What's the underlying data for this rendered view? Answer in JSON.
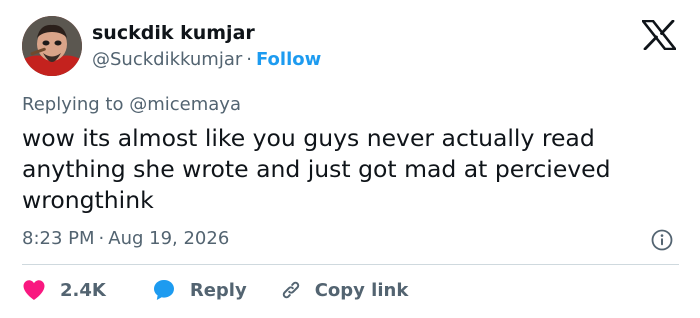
{
  "author": {
    "name": "suckdik kumjar",
    "handle": "@Suckdikkumjar",
    "separator": "·",
    "follow_label": "Follow"
  },
  "reply_context": {
    "prefix": "Replying to",
    "mention": "@micemaya"
  },
  "tweet": {
    "lines": [
      "wow its almost like you guys never actually read",
      "anything she wrote and just got mad at percieved",
      "wrongthink"
    ]
  },
  "meta": {
    "time": "8:23 PM",
    "separator": "·",
    "date": "Aug 19, 2026"
  },
  "actions": {
    "like_count": "2.4K",
    "reply_label": "Reply",
    "copy_label": "Copy link"
  },
  "icons": {
    "brand": "x-logo-icon",
    "info": "info-icon",
    "like": "heart-icon",
    "reply": "speech-bubble-icon",
    "copy": "link-icon"
  },
  "colors": {
    "accent": "#1d9bf0",
    "like": "#f91880",
    "text_primary": "#0f1419",
    "text_secondary": "#536471",
    "divider": "#cfd9de"
  }
}
